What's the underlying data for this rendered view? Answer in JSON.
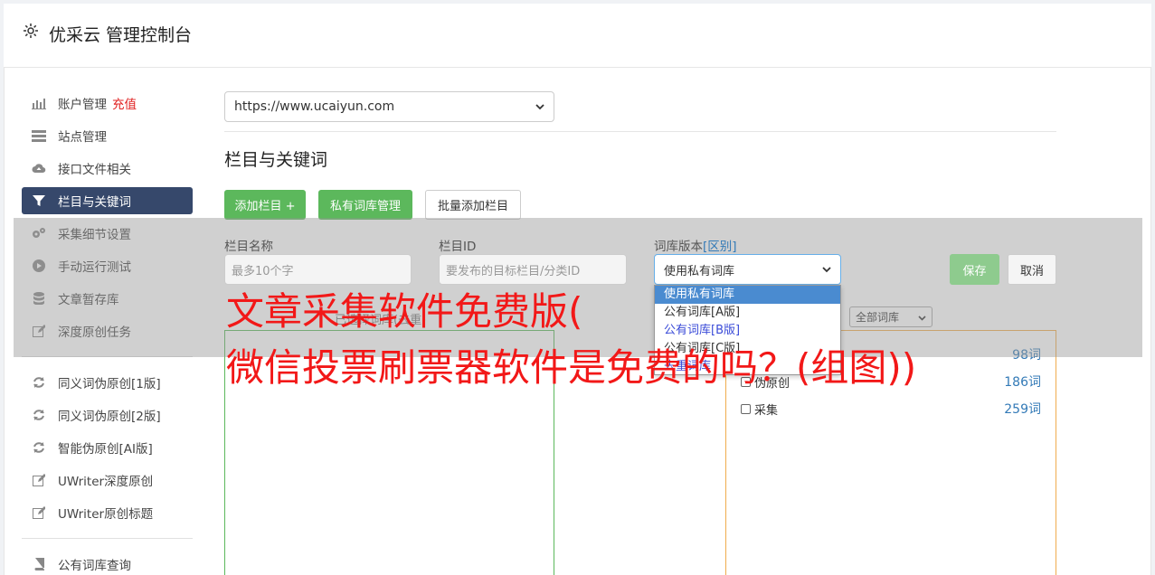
{
  "header": {
    "title": "优采云 管理控制台"
  },
  "sidebar": {
    "items": [
      {
        "label": "账户管理",
        "extra": "充值",
        "icon": "bar-chart-icon"
      },
      {
        "label": "站点管理",
        "icon": "server-icon"
      },
      {
        "label": "接口文件相关",
        "icon": "cloud-upload-icon"
      },
      {
        "label": "栏目与关键词",
        "icon": "filter-icon",
        "active": true
      },
      {
        "label": "采集细节设置",
        "icon": "gears-icon"
      },
      {
        "label": "手动运行测试",
        "icon": "play-circle-icon"
      },
      {
        "label": "文章暂存库",
        "icon": "database-icon"
      },
      {
        "label": "深度原创任务",
        "icon": "edit-icon"
      },
      {
        "label": "同义词伪原创[1版]",
        "icon": "refresh-icon"
      },
      {
        "label": "同义词伪原创[2版]",
        "icon": "refresh-icon"
      },
      {
        "label": "智能伪原创[AI版]",
        "icon": "refresh-icon"
      },
      {
        "label": "UWriter深度原创",
        "icon": "edit-icon"
      },
      {
        "label": "UWriter原创标题",
        "icon": "edit-icon"
      },
      {
        "label": "公有词库查询",
        "icon": "book-icon"
      }
    ]
  },
  "main": {
    "site_select": "https://www.ucaiyun.com",
    "section_title": "栏目与关键词",
    "buttons": {
      "add_column": "添加栏目 +",
      "private_lib": "私有词库管理",
      "batch_add": "批量添加栏目"
    },
    "form": {
      "name_label": "栏目名称",
      "name_placeholder": "最多10个字",
      "id_label": "栏目ID",
      "id_placeholder": "要发布的目标栏目/分类ID",
      "version_label": "词库版本",
      "version_link": "[区别]",
      "version_value": "使用私有词库",
      "save": "保存",
      "cancel": "取消"
    },
    "dropdown_options": [
      "使用私有词库",
      "公有词库[A版]",
      "公有词库[B版]",
      "公有词库[C版]",
      "去重词库"
    ],
    "lib_filter": "全部词库",
    "behind_label": "已选择词库(去重)",
    "libraries": [
      {
        "name": "",
        "count": "98词"
      },
      {
        "name": "伪原创",
        "count": "186词"
      },
      {
        "name": "采集",
        "count": "259词"
      }
    ]
  },
  "watermark": {
    "line1": "文章采集软件免费版(",
    "line2": "微信投票刷票器软件是免费的吗？(组图))"
  }
}
